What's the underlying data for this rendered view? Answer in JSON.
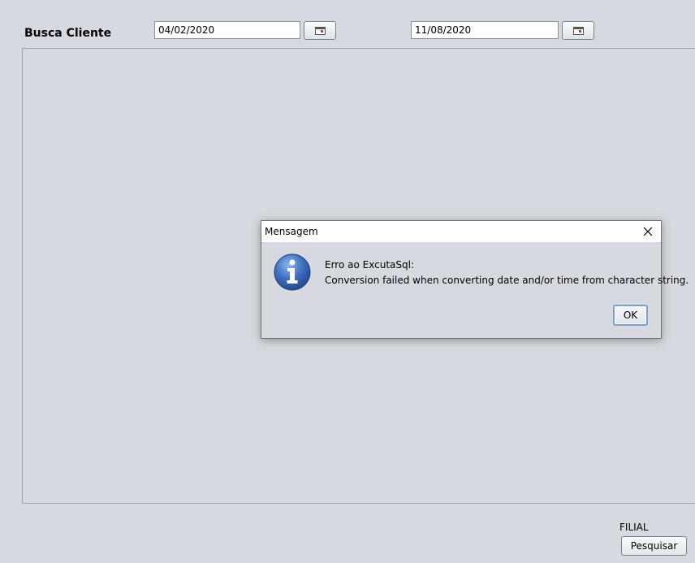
{
  "header": {
    "title": "Busca Cliente",
    "date_from": "04/02/2020",
    "date_to": "11/08/2020",
    "calendar_icon": "calendar-icon"
  },
  "footer": {
    "filial_label": "FILIAL",
    "search_button": "Pesquisar"
  },
  "dialog": {
    "title": "Mensagem",
    "icon": "info-icon",
    "close_icon": "close-icon",
    "message_line1": "Erro ao ExcutaSql:",
    "message_line2": "Conversion failed when converting date and/or time from character string.",
    "ok_label": "OK"
  }
}
